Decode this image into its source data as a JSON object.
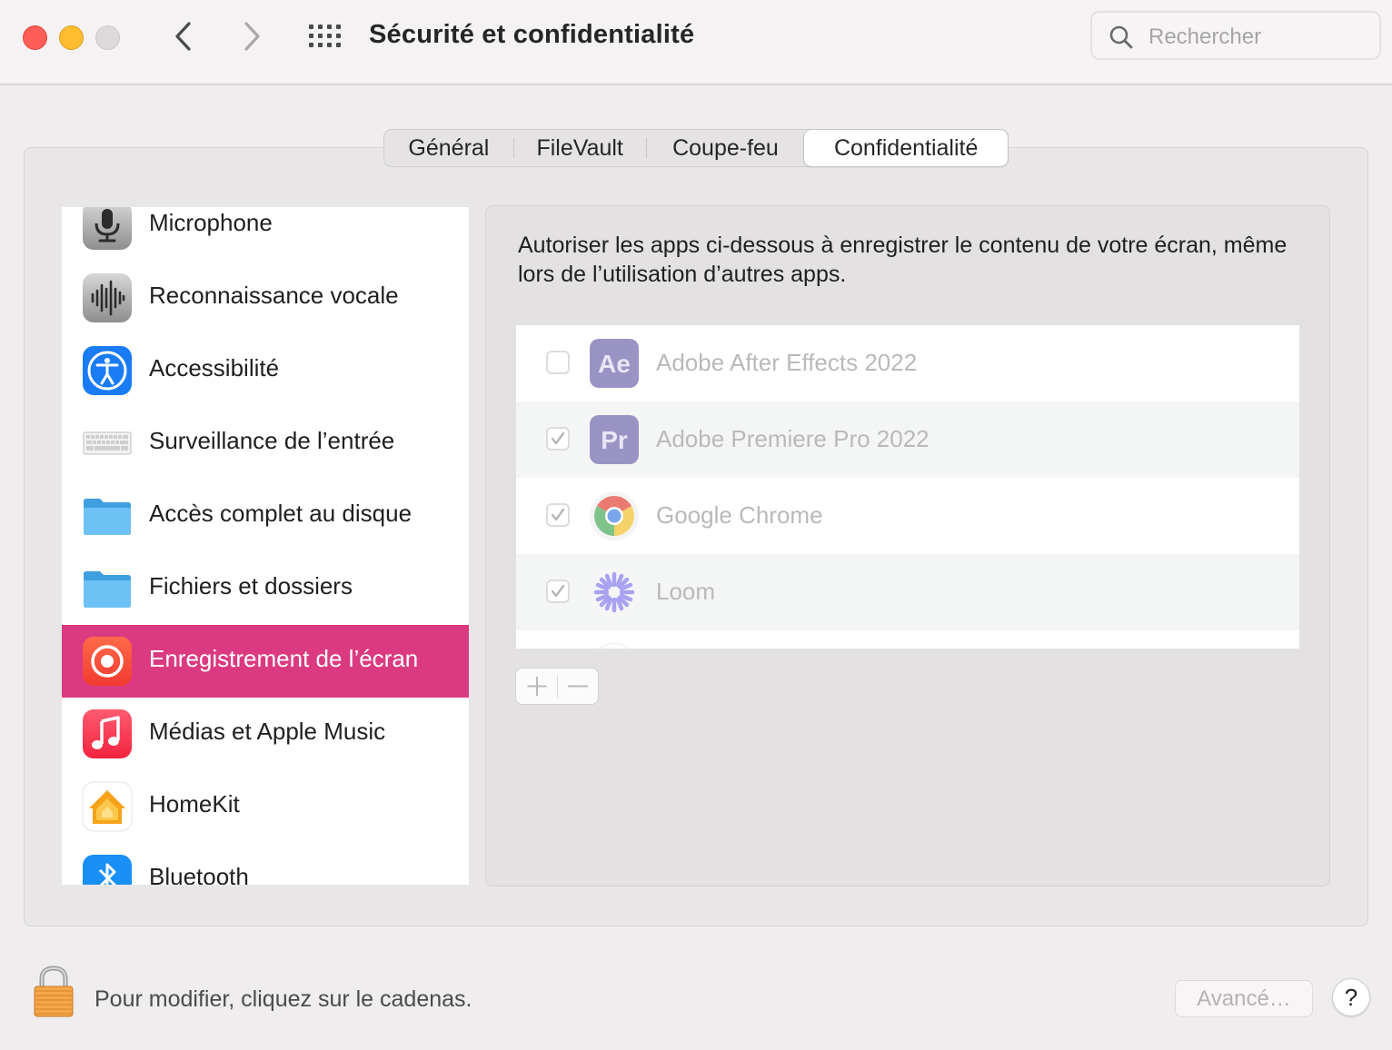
{
  "window": {
    "title": "Sécurité et confidentialité",
    "search_placeholder": "Rechercher"
  },
  "tabs": [
    {
      "label": "Général",
      "active": false
    },
    {
      "label": "FileVault",
      "active": false
    },
    {
      "label": "Coupe-feu",
      "active": false
    },
    {
      "label": "Confidentialité",
      "active": true
    }
  ],
  "sidebar": {
    "items": [
      {
        "label": "Microphone",
        "icon": "microphone-icon"
      },
      {
        "label": "Reconnaissance vocale",
        "icon": "waveform-icon"
      },
      {
        "label": "Accessibilité",
        "icon": "accessibility-icon"
      },
      {
        "label": "Surveillance de l’entrée",
        "icon": "keyboard-icon"
      },
      {
        "label": "Accès complet au disque",
        "icon": "folder-icon"
      },
      {
        "label": "Fichiers et dossiers",
        "icon": "folder-icon"
      },
      {
        "label": "Enregistrement de l’écran",
        "icon": "screen-record-icon",
        "selected": true
      },
      {
        "label": "Médias et Apple Music",
        "icon": "music-icon"
      },
      {
        "label": "HomeKit",
        "icon": "home-icon"
      },
      {
        "label": "Bluetooth",
        "icon": "bluetooth-icon"
      }
    ]
  },
  "main": {
    "description": "Autoriser les apps ci-dessous à enregistrer le contenu de votre écran, même lors de l’utilisation d’autres apps.",
    "apps": [
      {
        "name": "Adobe After Effects 2022",
        "icon_text": "Ae",
        "checked": false
      },
      {
        "name": "Adobe Premiere Pro 2022",
        "icon_text": "Pr",
        "checked": true
      },
      {
        "name": "Google Chrome",
        "icon": "chrome-icon",
        "checked": true
      },
      {
        "name": "Loom",
        "icon": "loom-icon",
        "checked": true
      }
    ]
  },
  "footer": {
    "lock_text": "Pour modifier, cliquez sur le cadenas.",
    "advanced_label": "Avancé…",
    "help_label": "?"
  },
  "colors": {
    "selection": "#db3a80",
    "ae_icon": "#9a94c4",
    "pr_icon": "#9a94c4"
  }
}
